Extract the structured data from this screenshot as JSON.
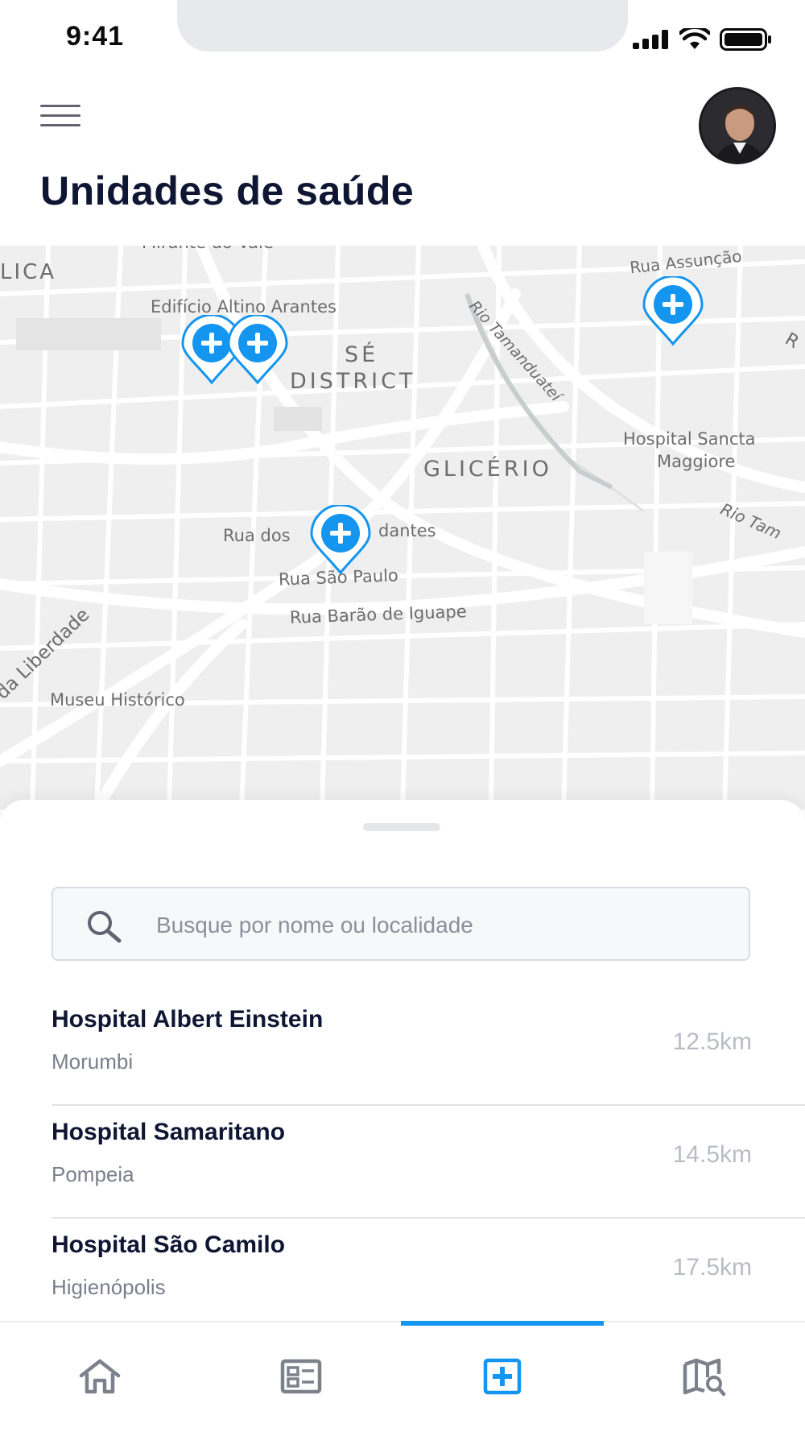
{
  "status_bar": {
    "time": "9:41"
  },
  "header": {
    "title": "Unidades de saúde"
  },
  "map": {
    "labels": {
      "mirante": "Mirante do Vale",
      "lica": "LICA",
      "edificio": "Edifício Altino Arantes",
      "se": "SÉ",
      "district": "DISTRICT",
      "rua_assuncao": "Rua Assunção",
      "rio_tamanduatei": "Rio Tamanduateí",
      "hospital_sancta_1": "Hospital Sancta",
      "hospital_sancta_2": "Maggiore",
      "glicerio": "GLICÉRIO",
      "rio_tam": "Rio Tam",
      "rua_dos": "Rua dos",
      "dantes": "dantes",
      "rua_sao_paulo": "Rua São Paulo",
      "rua_barao": "Rua Barão de Iguape",
      "liberdade": "da Liberdade",
      "museu": "Museu Histórico",
      "edge_r": "R"
    }
  },
  "search": {
    "placeholder": "Busque por nome ou localidade"
  },
  "hospitals": [
    {
      "name": "Hospital Albert Einstein",
      "area": "Morumbi",
      "distance": "12.5km"
    },
    {
      "name": "Hospital Samaritano",
      "area": "Pompeia",
      "distance": "14.5km"
    },
    {
      "name": "Hospital São Camilo",
      "area": "Higienópolis",
      "distance": "17.5km"
    }
  ],
  "tabs": [
    {
      "icon": "home-icon",
      "active": false
    },
    {
      "icon": "news-icon",
      "active": false
    },
    {
      "icon": "health-unit-icon",
      "active": true
    },
    {
      "icon": "map-search-icon",
      "active": false
    }
  ],
  "colors": {
    "accent": "#1495f0",
    "title": "#0f1633",
    "map_bg": "#efefef"
  }
}
